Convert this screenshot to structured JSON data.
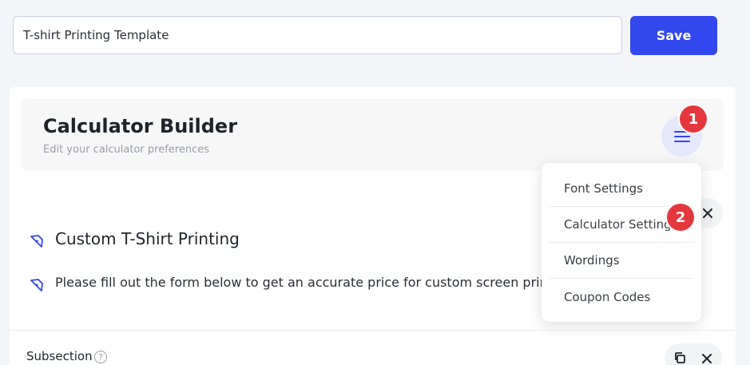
{
  "template_name": {
    "value": "T-shirt Printing Template"
  },
  "save_label": "Save",
  "builder": {
    "title": "Calculator Builder",
    "subtitle": "Edit your calculator preferences"
  },
  "menu": {
    "items": [
      "Font Settings",
      "Calculator Settings",
      "Wordings",
      "Coupon Codes"
    ]
  },
  "badges": [
    "1",
    "2"
  ],
  "rows": {
    "title": "Custom T-Shirt Printing",
    "description": "Please fill out the form below to get an accurate price for custom screen printing"
  },
  "subsection": {
    "label": "Subsection",
    "help": "?"
  },
  "colors": {
    "accent": "#3347ef",
    "badge": "#e5373e",
    "menu_bg": "#e5e8fb"
  }
}
